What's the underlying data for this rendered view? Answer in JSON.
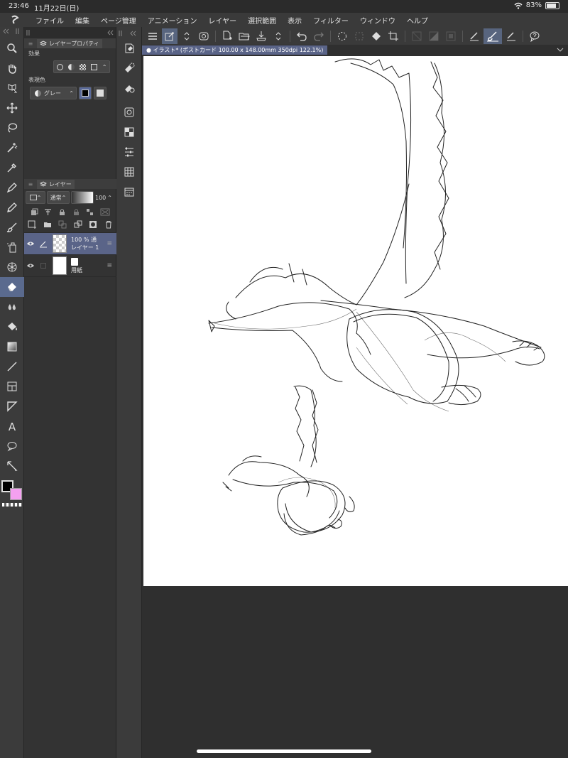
{
  "status": {
    "time": "23:46",
    "date": "11月22日(日)",
    "battery": "83%",
    "battery_level": 0.83
  },
  "menu": [
    "ファイル",
    "編集",
    "ページ管理",
    "アニメーション",
    "レイヤー",
    "選択範囲",
    "表示",
    "フィルター",
    "ウィンドウ",
    "ヘルプ"
  ],
  "left_tools": [
    "zoom-icon",
    "hand-icon",
    "object-select-icon",
    "move-icon",
    "lasso-icon",
    "magic-wand-icon",
    "eyedropper-icon",
    "pen-icon",
    "pencil-icon",
    "brush-icon",
    "airbrush-icon",
    "decoration-icon",
    "eraser-icon",
    "blend-icon",
    "fill-icon",
    "gradient-icon",
    "line-icon",
    "frame-icon",
    "ruler-icon",
    "text-icon",
    "balloon-icon",
    "correction-icon"
  ],
  "colors": {
    "main": "#000000",
    "sub": "#f4a0f0",
    "selected_accent": "#5a6488"
  },
  "layer_property": {
    "tab_label": "レイヤープロパティ",
    "effect_label": "効果",
    "expression_label": "表現色",
    "expression_value": "グレー"
  },
  "layer_panel": {
    "tab_label": "レイヤー",
    "blend_mode": "通常",
    "opacity": "100",
    "layers": [
      {
        "name": "レイヤー 1",
        "info": "100 % 通",
        "selected": true
      },
      {
        "name": "用紙",
        "info": "",
        "selected": false
      }
    ]
  },
  "document": {
    "tab_title": "イラスト* (ポストカード 100.00 x 148.00mm 350dpi 122.1%)"
  }
}
